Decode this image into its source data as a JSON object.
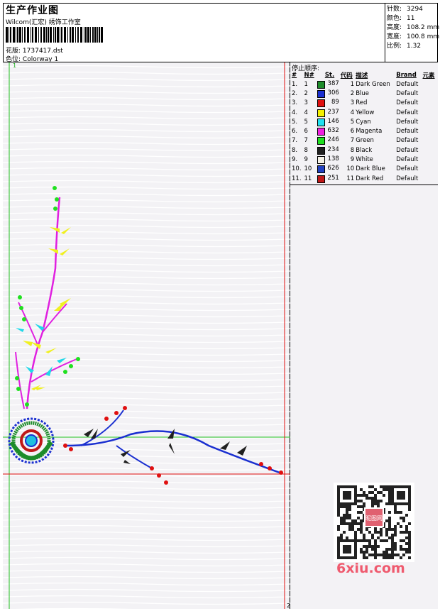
{
  "header": {
    "title": "生产作业图",
    "subtitle": "Wilcom(汇宏) 绣饰工作室",
    "design_label": "花版:",
    "design_value": "1737417.dst",
    "colorway_label": "色位:",
    "colorway_value": "Colorway 1"
  },
  "info": {
    "stitches_label": "针数:",
    "stitches_value": "3294",
    "colors_label": "颜色:",
    "colors_value": "11",
    "height_label": "高度:",
    "height_value": "108.2 mm",
    "width_label": "宽度:",
    "width_value": "100.8 mm",
    "ratio_label": "比例:",
    "ratio_value": "1.32"
  },
  "canvas": {
    "corner_mark_top": "1",
    "corner_mark_bottom": "2"
  },
  "stop_sequence": {
    "title": "停止顺序:",
    "headers": [
      "#",
      "N#",
      "St.",
      "代码",
      "描述",
      "Brand",
      "元素"
    ],
    "rows": [
      {
        "idx": "1.",
        "n": "1",
        "color": "#1d8c2a",
        "st": "387",
        "code": "1",
        "desc": "Dark Green",
        "brand": "Default"
      },
      {
        "idx": "2.",
        "n": "2",
        "color": "#1a2fd0",
        "st": "306",
        "code": "2",
        "desc": "Blue",
        "brand": "Default"
      },
      {
        "idx": "3.",
        "n": "3",
        "color": "#e01010",
        "st": "89",
        "code": "3",
        "desc": "Red",
        "brand": "Default"
      },
      {
        "idx": "4.",
        "n": "4",
        "color": "#f5f000",
        "st": "237",
        "code": "4",
        "desc": "Yellow",
        "brand": "Default"
      },
      {
        "idx": "5.",
        "n": "5",
        "color": "#20e0f0",
        "st": "146",
        "code": "5",
        "desc": "Cyan",
        "brand": "Default"
      },
      {
        "idx": "6.",
        "n": "6",
        "color": "#f020e0",
        "st": "632",
        "code": "6",
        "desc": "Magenta",
        "brand": "Default"
      },
      {
        "idx": "7.",
        "n": "7",
        "color": "#20e020",
        "st": "246",
        "code": "7",
        "desc": "Green",
        "brand": "Default"
      },
      {
        "idx": "8.",
        "n": "8",
        "color": "#202020",
        "st": "234",
        "code": "8",
        "desc": "Black",
        "brand": "Default"
      },
      {
        "idx": "9.",
        "n": "9",
        "color": "#f4f1e6",
        "st": "138",
        "code": "9",
        "desc": "White",
        "brand": "Default"
      },
      {
        "idx": "10.",
        "n": "10",
        "color": "#2040c0",
        "st": "626",
        "code": "10",
        "desc": "Dark Blue",
        "brand": "Default"
      },
      {
        "idx": "11.",
        "n": "11",
        "color": "#c01818",
        "st": "251",
        "code": "11",
        "desc": "Dark Red",
        "brand": "Default"
      }
    ]
  },
  "watermark": {
    "qr_stamp_text": "昵图网",
    "site_text": "6xiu.com"
  }
}
